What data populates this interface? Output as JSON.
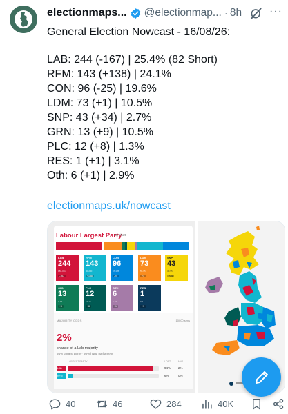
{
  "author": {
    "display_name": "electionmaps...",
    "handle": "@electionmap...",
    "separator": "·",
    "time": "8h",
    "more_label": "···"
  },
  "post": {
    "headline": "General Election Nowcast - 16/08/26:",
    "lines": [
      "LAB: 244 (-167) | 25.4% (82 Short)",
      "RFM: 143 (+138) | 24.1%",
      "CON: 96 (-25) | 19.6%",
      "LDM: 73 (+1) | 10.5%",
      "SNP: 43 (+34) | 2.7%",
      "GRN: 13 (+9) | 10.5%",
      "PLC: 12 (+8) | 1.3%",
      "RES: 1 (+1) | 3.1%",
      "Oth: 6 (+1) | 2.9%"
    ],
    "link": "electionmaps.uk/nowcast"
  },
  "media": {
    "card_title": "Labour Largest Party",
    "card_subtitle": "82 short",
    "parties": [
      {
        "name": "LAB",
        "seats": "244",
        "range": "180-311",
        "change": "-167",
        "color": "#d2143a"
      },
      {
        "name": "RFM",
        "seats": "143",
        "range": "90-200",
        "change": "+138",
        "color": "#12b6cf"
      },
      {
        "name": "CON",
        "seats": "96",
        "range": "57-135",
        "change": "-25",
        "color": "#0087dc"
      },
      {
        "name": "LDM",
        "seats": "73",
        "range": "55-95",
        "change": "+1",
        "color": "#fa8c1e"
      },
      {
        "name": "SNP",
        "seats": "43",
        "range": "30-55",
        "change": "+34",
        "color": "#f5d60a"
      },
      {
        "name": "GRN",
        "seats": "13",
        "range": "7-17",
        "change": "+9",
        "color": "#0f7b56"
      },
      {
        "name": "PLC",
        "seats": "12",
        "range": "10-16",
        "change": "+8",
        "color": "#005b54"
      },
      {
        "name": "OTH",
        "seats": "6",
        "range": "5-10",
        "change": "+1",
        "color": "#a57ba8"
      },
      {
        "name": "RES",
        "seats": "1",
        "range": "0-1",
        "change": "+1",
        "color": "#0b3a5c"
      }
    ],
    "majority_label": "MAJORITY ODDS",
    "majority_label_right": "10000 sims",
    "majority_pct": "2%",
    "majority_line1": "chance of a Lab majority",
    "majority_line2": "94% largest party · 98% hung parliament",
    "table_headers": {
      "party": "LARGEST PARTY",
      "lost": "LOST",
      "maj": "MAJ"
    },
    "rows": [
      {
        "tag": "LAB",
        "color": "#d2143a",
        "fill": 0.94,
        "v1": "94%",
        "v2": "2%"
      },
      {
        "tag": "RFM",
        "color": "#12b6cf",
        "fill": 0.06,
        "v1": "6%",
        "v2": "0%"
      }
    ]
  },
  "actions": {
    "replies": "40",
    "reposts": "46",
    "likes": "284",
    "views": "40K"
  },
  "colors": {
    "accent": "#1d9bf0",
    "muted": "#536471"
  }
}
